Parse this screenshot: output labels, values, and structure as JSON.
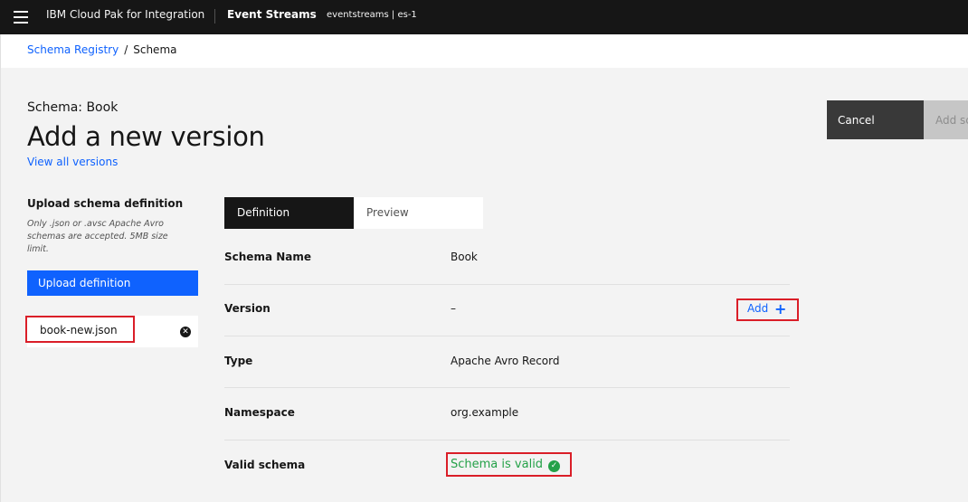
{
  "header": {
    "brand": "IBM Cloud Pak for Integration",
    "product": "Event Streams",
    "instance": "eventstreams | es-1",
    "menu_icon": "hamburger-menu-icon"
  },
  "breadcrumb": {
    "parent": "Schema Registry",
    "separator": "/",
    "current": "Schema"
  },
  "page": {
    "subtitle": "Schema: Book",
    "title": "Add a new version",
    "view_all": "View all versions",
    "cancel_label": "Cancel",
    "add_schema_label": "Add schema"
  },
  "upload": {
    "heading": "Upload schema definition",
    "note": "Only .json or .avsc Apache Avro schemas are accepted. 5MB size limit.",
    "button_label": "Upload definition",
    "file_name": "book-new.json",
    "remove_icon": "close-filled-icon"
  },
  "tabs": [
    {
      "label": "Definition",
      "active": true
    },
    {
      "label": "Preview",
      "active": false
    }
  ],
  "details": {
    "rows": [
      {
        "label": "Schema Name",
        "value": "Book"
      },
      {
        "label": "Version",
        "value": "–",
        "action": "Add"
      },
      {
        "label": "Type",
        "value": "Apache Avro Record"
      },
      {
        "label": "Namespace",
        "value": "org.example"
      },
      {
        "label": "Valid schema",
        "value": "Schema is valid"
      }
    ]
  },
  "colors": {
    "link": "#0f62fe",
    "valid": "#24a148",
    "highlight": "#da1e28",
    "header_bg": "#161616"
  }
}
